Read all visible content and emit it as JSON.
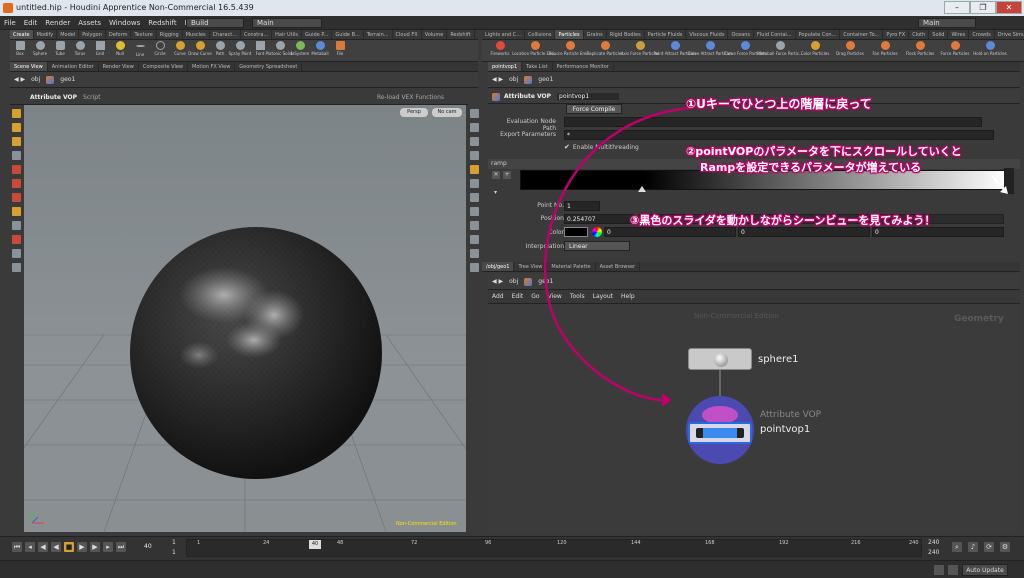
{
  "window": {
    "title": "untitled.hip - Houdini Apprentice Non-Commercial 16.5.439",
    "controls": [
      "–",
      "❐",
      "✕"
    ]
  },
  "menubar": {
    "items": [
      "File",
      "Edit",
      "Render",
      "Assets",
      "Windows",
      "Redshift",
      "Help"
    ],
    "build_dropdown": "Build",
    "main_dropdown": "Main",
    "right_dropdown": "Main"
  },
  "shelf_left": {
    "tabs": [
      "Create",
      "Modify",
      "Model",
      "Polygon",
      "Deform",
      "Texture",
      "Rigging",
      "Muscles",
      "Charact...",
      "Constra...",
      "Hair Utils",
      "Guide P...",
      "Guide B...",
      "Terrain...",
      "Cloud FX",
      "Volume",
      "Redshift"
    ],
    "tools": [
      "Box",
      "Sphere",
      "Tube",
      "Torus",
      "Grid",
      "Null",
      "Line",
      "Circle",
      "Curve",
      "Draw Curve",
      "Path",
      "Spray Paint",
      "Font",
      "Platonic Solids",
      "L-System",
      "Metaball",
      "File"
    ]
  },
  "shelf_right": {
    "tabs": [
      "Lights and C...",
      "Collisions",
      "Particles",
      "Grains",
      "Rigid Bodies",
      "Particle Fluids",
      "Viscous Fluids",
      "Oceans",
      "Fluid Contai...",
      "Populate Con...",
      "Container To...",
      "Pyro FX",
      "Cloth",
      "Solid",
      "Wires",
      "Crowds",
      "Drive Simul..."
    ],
    "active_tab": "Particles",
    "tools": [
      "Fireworks",
      "Location Particle Emi...",
      "Source Particle Emi...",
      "Replicate Particles",
      "Axis Force Particles",
      "Point Attract Particles",
      "Curve Attract Particles",
      "Curve Force Particles",
      "Metaball Force Partic...",
      "Color Particles",
      "Drag Particles",
      "Fan Particles",
      "Flock Particles",
      "Force Particles",
      "Hold on Particles"
    ]
  },
  "left_pane": {
    "tabs": [
      "Scene View",
      "Animation Editor",
      "Render View",
      "Composite View",
      "Motion FX View",
      "Geometry Spreadsheet"
    ],
    "path": [
      "obj",
      "geo1"
    ],
    "toolbar_title": "Attribute VOP",
    "toolbar_sub": "Script",
    "toolbar_right": "Re-load VEX Functions",
    "persp": "Persp",
    "cam": "No cam",
    "watermark": "Non-Commercial Edition"
  },
  "param_pane": {
    "tabs": [
      "pointvop1",
      "Take List",
      "Performance Monitor"
    ],
    "path": [
      "obj",
      "geo1"
    ],
    "node_type": "Attribute VOP",
    "node_name": "pointvop1",
    "force_compile": "Force Compile",
    "eval_label": "Evaluation Node Path",
    "export_label": "Export Parameters",
    "export_value": "*",
    "multithread_label": "Enable Multithreading",
    "ramp_label": "ramp",
    "point_no_label": "Point No.",
    "point_no_value": "1",
    "position_label": "Position",
    "position_value": "0.254707",
    "color_label": "Color",
    "color_values": [
      "0",
      "0",
      "0"
    ],
    "interp_label": "Interpolation",
    "interp_value": "Linear"
  },
  "network_pane": {
    "tabs": [
      "/obj/geo1",
      "Tree View",
      "Material Palette",
      "Asset Browser"
    ],
    "path": [
      "obj",
      "geo1"
    ],
    "menu": [
      "Add",
      "Edit",
      "Go",
      "View",
      "Tools",
      "Layout",
      "Help"
    ],
    "watermark": "Non-Commercial Edition",
    "context_label": "Geometry",
    "node1_name": "sphere1",
    "node2_type": "Attribute VOP",
    "node2_name": "pointvop1"
  },
  "timeline": {
    "current_frame": "40",
    "start": "1",
    "start2": "1",
    "ticks": [
      "1",
      "24",
      "48",
      "72",
      "96",
      "120",
      "144",
      "168",
      "192",
      "216",
      "240"
    ],
    "end": "240",
    "end2": "240",
    "marker": "40",
    "autoupdate": "Auto Update"
  },
  "annotations": {
    "a1": "①Uキーでひとつ上の階層に戻って",
    "a2_line1": "②pointVOPのパラメータを下にスクロールしていくと",
    "a2_line2": "Rampを設定できるパラメータが増えている",
    "a3": "③黒色のスライダを動かしながらシーンビューを見てみよう！",
    "color": "#c0006a"
  }
}
